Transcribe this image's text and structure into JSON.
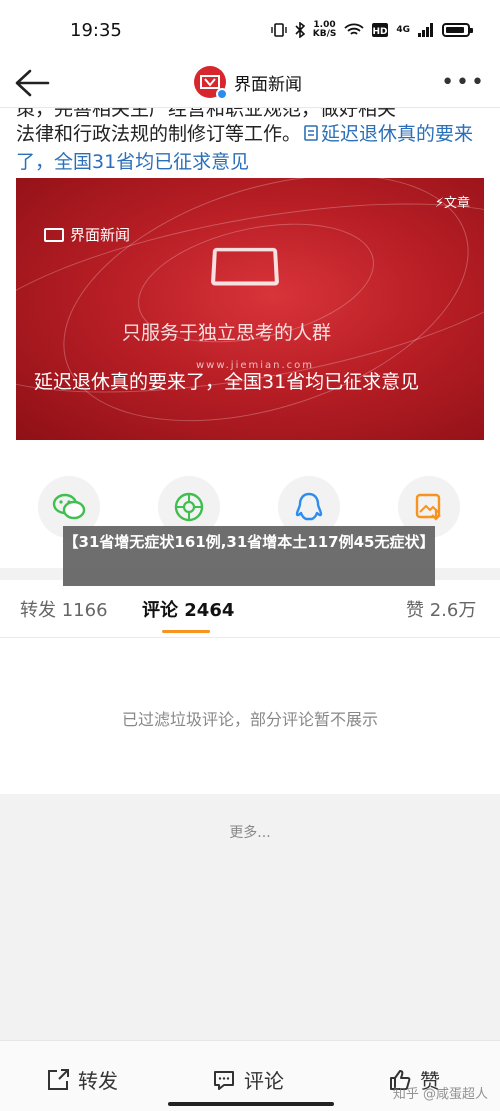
{
  "status_bar": {
    "time": "19:35",
    "speed_value": "1.00",
    "speed_unit": "KB/S",
    "network_label": "4G"
  },
  "nav": {
    "title": "界面新闻"
  },
  "article": {
    "partial_top_line": "策，完善相关生产经营和职业规范，做好相关",
    "para_main": "法律和行政法规的制修订等工作。",
    "para_link": "延迟退休真的要来了，全国31省均已征求意见",
    "card": {
      "brand": "界面新闻",
      "tag": "文章",
      "slogan": "只服务于独立思考的人群",
      "url": "www.jiemian.com",
      "caption": "延迟退休真的要来了，全国31省均已征求意见"
    }
  },
  "share_buttons": [
    {
      "name": "wechat-share"
    },
    {
      "name": "moments-share"
    },
    {
      "name": "qq-share"
    },
    {
      "name": "save-image"
    }
  ],
  "toast": {
    "text": "【31省增无症状161例,31省增本土117例45无症状】"
  },
  "tabs": {
    "repost": "转发 1166",
    "comment": "评论 2464",
    "like": "赞 2.6万"
  },
  "comments": {
    "notice": "已过滤垃圾评论，部分评论暂不展示"
  },
  "more_label": "更多...",
  "bottom_bar": {
    "repost": "转发",
    "comment": "评论",
    "like": "赞"
  },
  "watermark": "知乎 @咸蛋超人",
  "colors": {
    "accent": "#f7931e",
    "link": "#2b6fb8",
    "brand_red": "#d7262e"
  }
}
